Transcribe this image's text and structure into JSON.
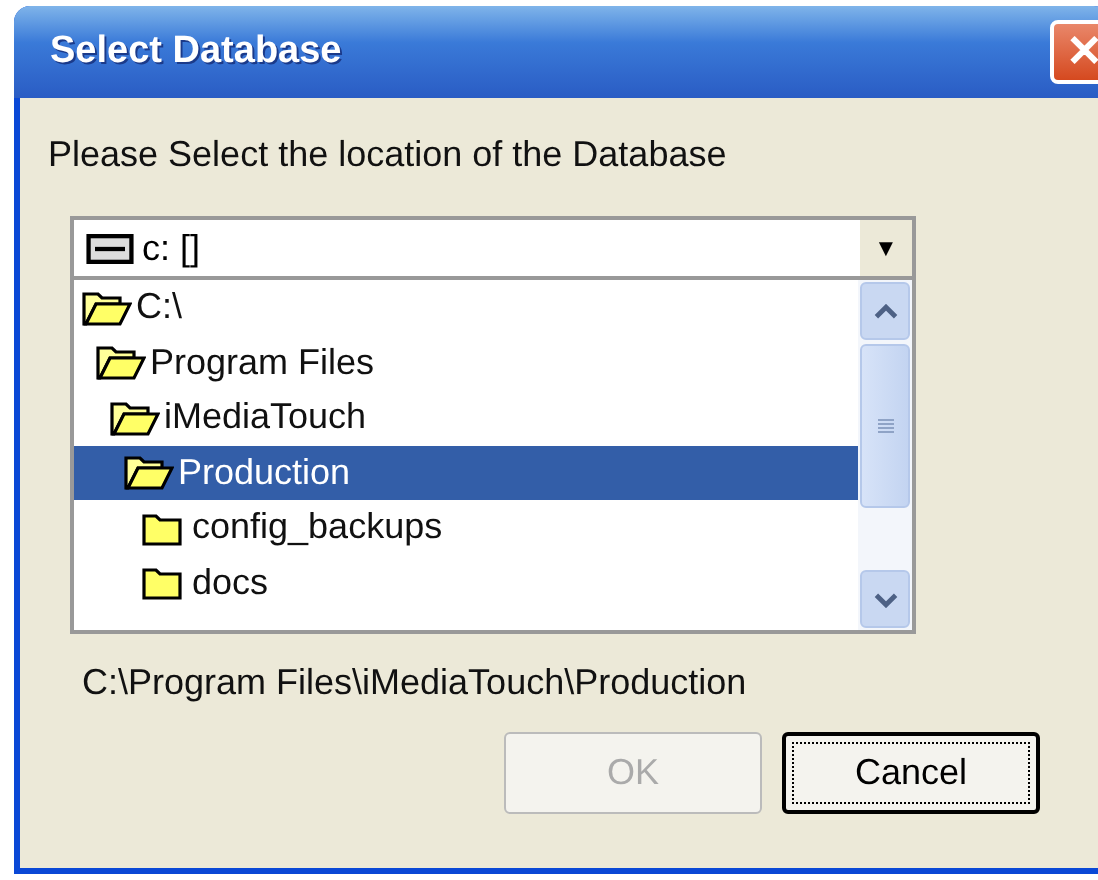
{
  "window": {
    "title": "Select Database",
    "close": "✕"
  },
  "prompt": "Please Select the location of the Database",
  "drive": {
    "value": "c: []",
    "arrow": "▼"
  },
  "tree": [
    {
      "label": "C:\\",
      "expanded": true,
      "selected": false,
      "children": [
        {
          "label": "Program Files",
          "expanded": true,
          "selected": false,
          "children": [
            {
              "label": "iMediaTouch",
              "expanded": true,
              "selected": false,
              "children": [
                {
                  "label": "Production",
                  "expanded": true,
                  "selected": true,
                  "children": [
                    {
                      "label": "config_backups",
                      "expanded": false,
                      "selected": false
                    },
                    {
                      "label": "docs",
                      "expanded": false,
                      "selected": false
                    }
                  ]
                }
              ]
            }
          ]
        }
      ]
    }
  ],
  "path": "C:\\Program Files\\iMediaTouch\\Production",
  "buttons": [
    {
      "label": "OK",
      "disabled": true,
      "focused": false
    },
    {
      "label": "Cancel",
      "disabled": false,
      "focused": true
    }
  ]
}
